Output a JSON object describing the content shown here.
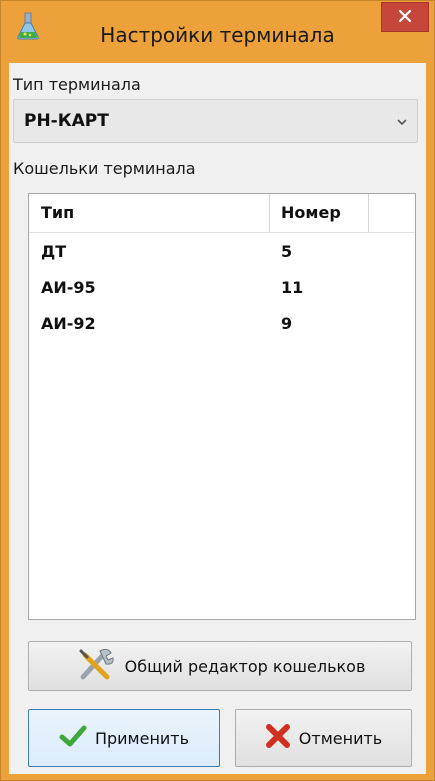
{
  "window": {
    "title": "Настройки терминала",
    "close_icon": "close-icon",
    "app_icon": "flask-icon"
  },
  "terminal_type": {
    "label": "Тип терминала",
    "selected": "РН-КАРТ"
  },
  "wallets": {
    "label": "Кошельки терминала",
    "columns": [
      "Тип",
      "Номер"
    ],
    "rows": [
      {
        "type": "ДТ",
        "number": "5"
      },
      {
        "type": "АИ-95",
        "number": "11"
      },
      {
        "type": "АИ-92",
        "number": "9"
      }
    ]
  },
  "buttons": {
    "editor_label": "Общий редактор кошельков",
    "editor_icon": "tools-icon",
    "apply_label": "Применить",
    "apply_icon": "checkmark-icon",
    "cancel_label": "Отменить",
    "cancel_icon": "cross-icon"
  },
  "colors": {
    "title_bar": "#eca13a",
    "close_button": "#c7463a",
    "focus_border": "#3c7fb1"
  }
}
